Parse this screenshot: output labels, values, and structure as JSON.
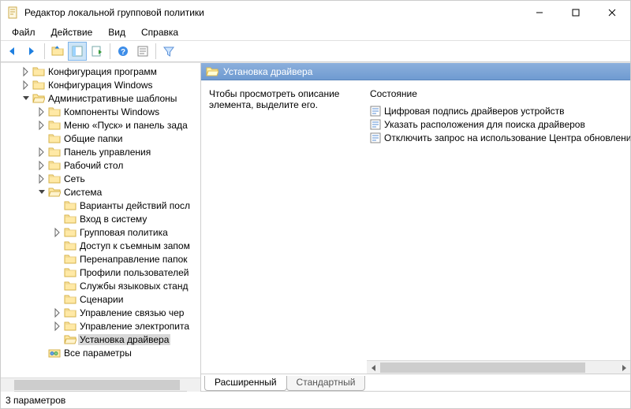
{
  "window": {
    "title": "Редактор локальной групповой политики"
  },
  "menu": {
    "file": "Файл",
    "action": "Действие",
    "view": "Вид",
    "help": "Справка"
  },
  "tree": {
    "n0": "Конфигурация программ",
    "n1": "Конфигурация Windows",
    "n2": "Административные шаблоны",
    "n2_0": "Компоненты Windows",
    "n2_1": "Меню «Пуск» и панель зада",
    "n2_2": "Общие папки",
    "n2_3": "Панель управления",
    "n2_4": "Рабочий стол",
    "n2_5": "Сеть",
    "n2_6": "Система",
    "n2_6_0": "Варианты действий посл",
    "n2_6_1": "Вход в систему",
    "n2_6_2": "Групповая политика",
    "n2_6_3": "Доступ к съемным запом",
    "n2_6_4": "Перенаправление папок",
    "n2_6_5": "Профили пользователей",
    "n2_6_6": "Службы языковых станд",
    "n2_6_7": "Сценарии",
    "n2_6_8": "Управление связью чер",
    "n2_6_9": "Управление электропита",
    "n2_6_10": "Установка драйвера",
    "n2_7": "Все параметры"
  },
  "right": {
    "header": "Установка драйвера",
    "hint": "Чтобы просмотреть описание элемента, выделите его.",
    "column": "Состояние",
    "items": [
      "Цифровая подпись драйверов устройств",
      "Указать расположения для поиска драйверов",
      "Отключить запрос на использование Центра обновления"
    ]
  },
  "tabs": {
    "ext": "Расширенный",
    "std": "Стандартный"
  },
  "status": {
    "text": "3 параметров"
  }
}
